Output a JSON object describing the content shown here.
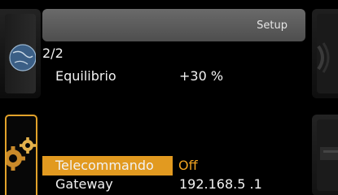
{
  "header": {
    "title": "Setup"
  },
  "page_indicator": "2/2",
  "rows": [
    {
      "label": "Equilibrio",
      "value": "+30 %"
    },
    {
      "label": "Telecommando",
      "value": "Off",
      "selected": true
    },
    {
      "label": "Gateway",
      "value": "192.168.5 .1"
    }
  ],
  "icons": {
    "left_top": "globe-icon",
    "left_active": "gears-icon",
    "right_top": "speaker-icon",
    "right_bottom": "device-icon"
  },
  "colors": {
    "accent": "#e29a20",
    "header_bg": "#5a5a5a",
    "text": "#f2f2f2"
  }
}
